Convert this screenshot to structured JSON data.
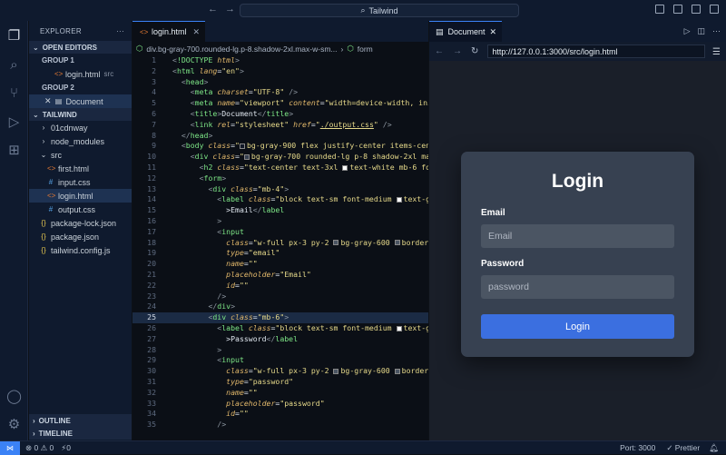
{
  "window": {
    "title": "Tailwind"
  },
  "explorer": {
    "title": "EXPLORER",
    "more": "···",
    "open_editors": "OPEN EDITORS",
    "group1": "GROUP 1",
    "group1_file": "login.html",
    "group1_file_hint": "src",
    "group2": "GROUP 2",
    "group2_item": "Document",
    "workspace": "TAILWIND",
    "tree": [
      {
        "label": "01cdnway",
        "kind": "folder"
      },
      {
        "label": "node_modules",
        "kind": "folder"
      },
      {
        "label": "src",
        "kind": "folder-open"
      },
      {
        "label": "first.html",
        "kind": "html"
      },
      {
        "label": "input.css",
        "kind": "css"
      },
      {
        "label": "login.html",
        "kind": "html"
      },
      {
        "label": "output.css",
        "kind": "css"
      },
      {
        "label": "package-lock.json",
        "kind": "json"
      },
      {
        "label": "package.json",
        "kind": "json"
      },
      {
        "label": "tailwind.config.js",
        "kind": "json"
      }
    ],
    "outline": "OUTLINE",
    "timeline": "TIMELINE"
  },
  "editor": {
    "tab": "login.html",
    "breadcrumb": "div.bg-gray-700.rounded-lg.p-8.shadow-2xl.max-w-sm...",
    "breadcrumb_tail": "form"
  },
  "browser": {
    "tab": "Document",
    "url": "http://127.0.0.1:3000/src/login.html",
    "form": {
      "title": "Login",
      "email_label": "Email",
      "email_placeholder": "Email",
      "password_label": "Password",
      "password_placeholder": "password",
      "submit": "Login"
    }
  },
  "status": {
    "problems": "⊗ 0 ⚠ 0",
    "ports": "⚡0",
    "port": "Port: 3000",
    "prettier": "✓ Prettier"
  }
}
